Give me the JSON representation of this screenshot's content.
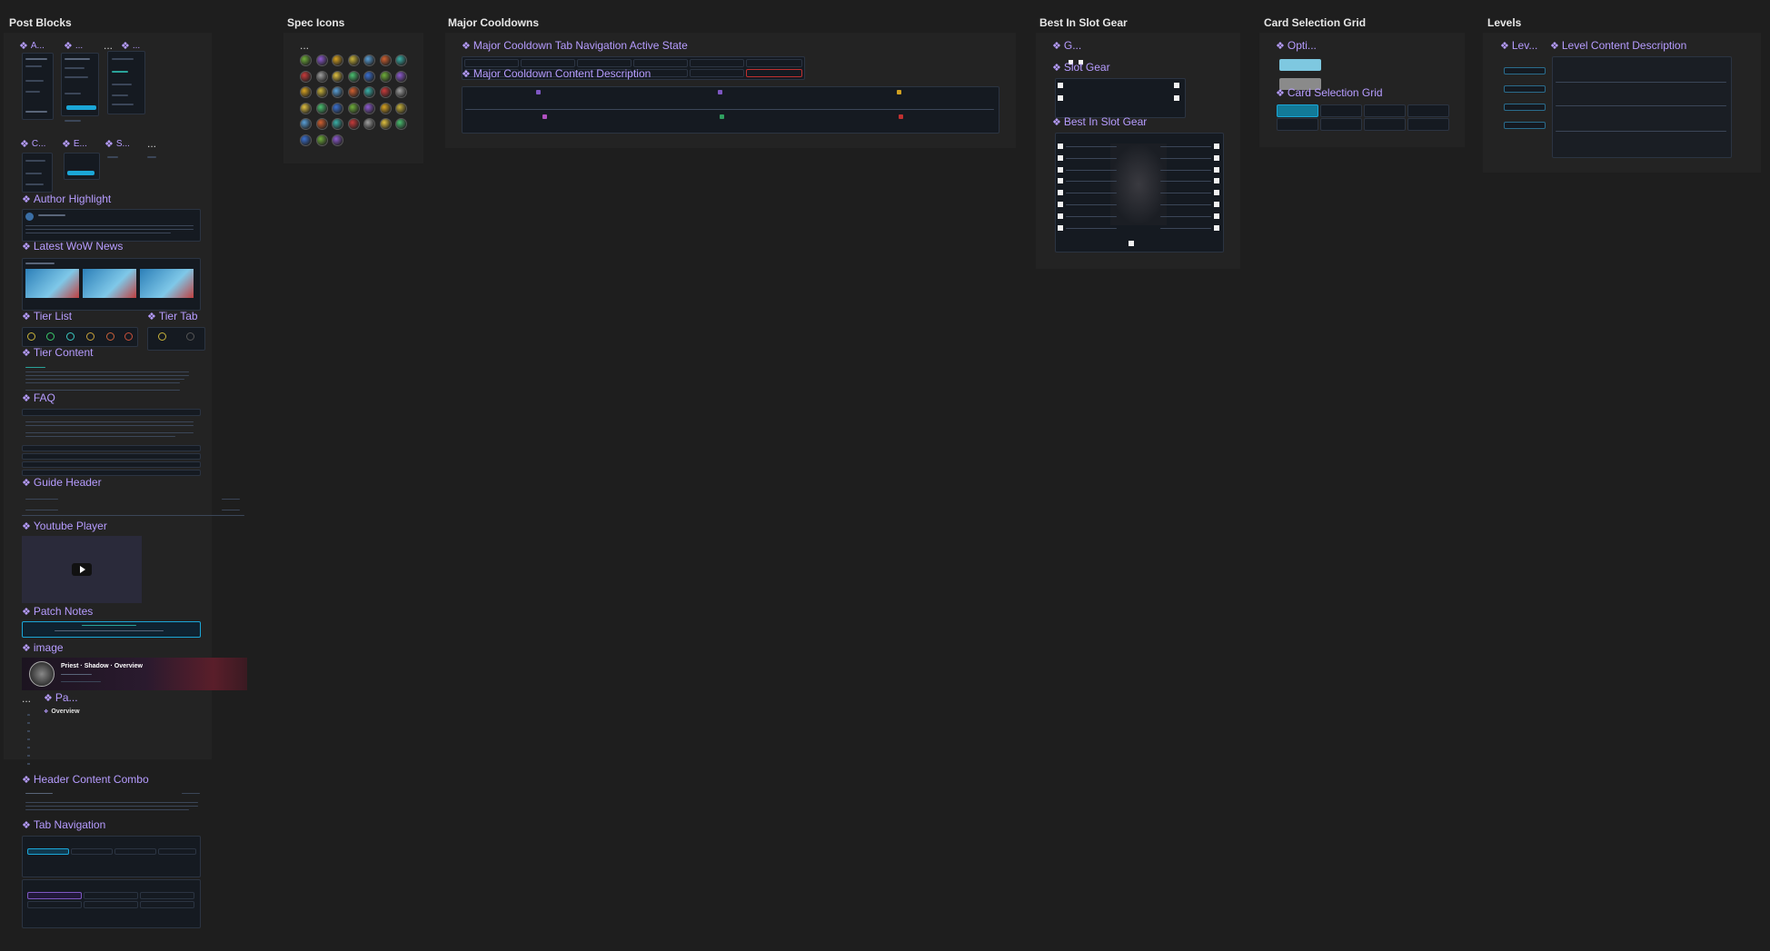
{
  "sections": {
    "post_blocks": "Post Blocks",
    "spec_icons": "Spec Icons",
    "major_cooldowns": "Major Cooldowns",
    "best_in_slot_gear": "Best In Slot Gear",
    "card_selection_grid": "Card Selection Grid",
    "levels": "Levels"
  },
  "post_blocks": {
    "comp_a": "A...",
    "comp_b": "...",
    "comp_c": "...",
    "comp_d": "...",
    "comp_e": "C...",
    "comp_f": "E...",
    "comp_g": "S...",
    "comp_h": "...",
    "author_highlight": "Author Highlight",
    "latest_wow_news": "Latest WoW News",
    "tier_list": "Tier List",
    "tier_tab": "Tier Tab",
    "tier_content": "Tier Content",
    "faq": "FAQ",
    "guide_header": "Guide Header",
    "youtube_player": "Youtube Player",
    "patch_notes": "Patch Notes",
    "image": "image",
    "image_breadcrumb": {
      "class": "Priest",
      "spec": "Shadow",
      "page": "Overview"
    },
    "pa": "Pa...",
    "overview": "Overview",
    "header_content_combo": "Header Content Combo",
    "tab_navigation": "Tab Navigation"
  },
  "major_cooldowns": {
    "tab_nav_active": "Major Cooldown Tab Navigation Active State",
    "content_desc": "Major Cooldown Content Description"
  },
  "bis": {
    "g": "G...",
    "slot_gear": "Slot Gear",
    "best_in_slot_gear": "Best In Slot Gear"
  },
  "card_selection": {
    "opti": "Opti...",
    "card_selection_grid": "Card Selection Grid"
  },
  "levels": {
    "lev": "Lev...",
    "level_content_description": "Level Content Description"
  },
  "colors": {
    "background": "#1e1e1e",
    "section": "#232323",
    "component_label": "#b69cff",
    "accent_blue": "#1ba6d7",
    "accent_teal": "#2aa39a"
  }
}
